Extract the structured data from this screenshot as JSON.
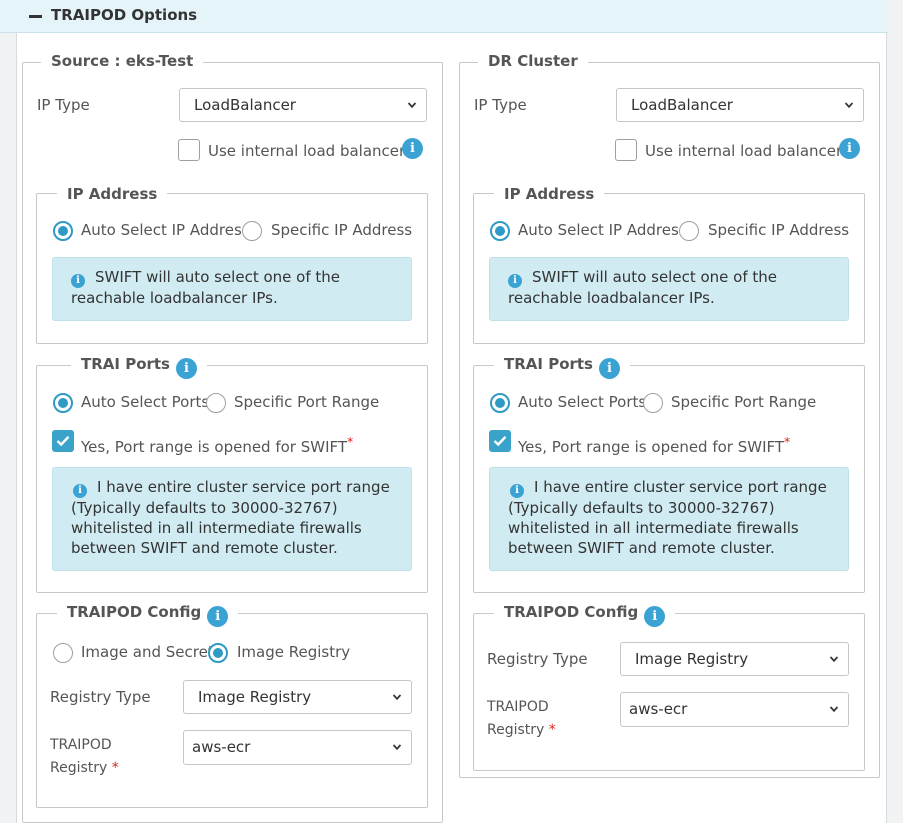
{
  "header": {
    "title": "TRAIPOD Options"
  },
  "source": {
    "legend": "Source : eks-Test",
    "ip_type_label": "IP Type",
    "ip_type_value": "LoadBalancer",
    "internal_lb_label": "Use internal load balancer",
    "ip_address": {
      "legend": "IP Address",
      "auto_label": "Auto Select IP Address",
      "specific_label": "Specific IP Address",
      "info": "SWIFT will auto select one of the reachable loadbalancer IPs."
    },
    "trai_ports": {
      "legend": "TRAI Ports",
      "auto_label": "Auto Select Ports",
      "specific_label": "Specific Port Range",
      "confirm_label": "Yes, Port range is opened for SWIFT",
      "required_mark": "*",
      "info": "I have entire cluster service port range (Typically defaults to 30000-32767) whitelisted in all intermediate firewalls between SWIFT and remote cluster."
    },
    "traipod_config": {
      "legend": "TRAIPOD Config",
      "image_secret_label": "Image and Secret",
      "image_registry_label": "Image Registry",
      "registry_type_label": "Registry Type",
      "registry_type_value": "Image Registry",
      "traipod_registry_label_1": "TRAIPOD",
      "traipod_registry_label_2": "Registry",
      "required_mark": "*",
      "traipod_registry_value": "aws-ecr"
    }
  },
  "dr": {
    "legend": "DR Cluster",
    "ip_type_label": "IP Type",
    "ip_type_value": "LoadBalancer",
    "internal_lb_label": "Use internal load balancer",
    "ip_address": {
      "legend": "IP Address",
      "auto_label": "Auto Select IP Address",
      "specific_label": "Specific IP Address",
      "info": "SWIFT will auto select one of the reachable loadbalancer IPs."
    },
    "trai_ports": {
      "legend": "TRAI Ports",
      "auto_label": "Auto Select Ports",
      "specific_label": "Specific Port Range",
      "confirm_label": "Yes, Port range is opened for SWIFT",
      "required_mark": "*",
      "info": "I have entire cluster service port range (Typically defaults to 30000-32767) whitelisted in all intermediate firewalls between SWIFT and remote cluster."
    },
    "traipod_config": {
      "legend": "TRAIPOD Config",
      "registry_type_label": "Registry Type",
      "registry_type_value": "Image Registry",
      "traipod_registry_label_1": "TRAIPOD",
      "traipod_registry_label_2": "Registry",
      "required_mark": "*",
      "traipod_registry_value": "aws-ecr"
    }
  },
  "icons": {
    "collapse": "minus-icon",
    "info": "info-icon",
    "chevron": "chevron-down-icon",
    "check": "check-icon"
  },
  "colors": {
    "accent": "#2f9ac4",
    "info_bg": "#d1ebf2",
    "header_bg": "#e5f4f9",
    "required": "#d9261c"
  }
}
